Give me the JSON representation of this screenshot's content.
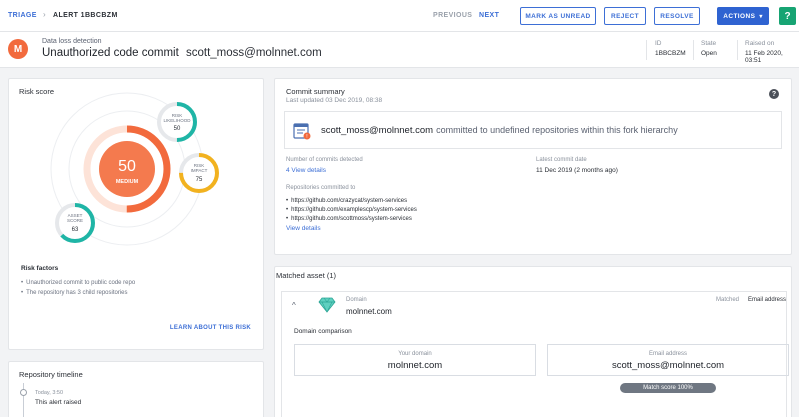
{
  "topbar": {
    "breadcrumb_root": "TRIAGE",
    "breadcrumb_sep": "›",
    "alert_id": "ALERT 1BBCBZM",
    "previous": "PREVIOUS",
    "next": "NEXT",
    "mark_unread": "MARK AS UNREAD",
    "reject": "REJECT",
    "resolve": "RESOLVE",
    "actions": "ACTIONS",
    "actions_caret": "▾",
    "help": "?"
  },
  "header": {
    "avatar_letter": "M",
    "alert_type": "Data loss detection",
    "title": "Unauthorized code commit",
    "email": "scott_moss@molnnet.com",
    "meta": {
      "id_label": "ID",
      "id_value": "1BBCBZM",
      "state_label": "State",
      "state_value": "Open",
      "raised_label": "Raised on",
      "raised_value": "11 Feb 2020, 03:51"
    }
  },
  "risk": {
    "title": "Risk score",
    "score": "50",
    "level": "MEDIUM",
    "likelihood_label_1": "RISK",
    "likelihood_label_2": "LIKELIHOOD",
    "likelihood_value": "50",
    "impact_label_1": "RISK",
    "impact_label_2": "IMPACT",
    "impact_value": "75",
    "asset_label_1": "ASSET",
    "asset_label_2": "SCORE",
    "asset_value": "63",
    "factors_title": "Risk factors",
    "factors": [
      "Unauthorized commit to public code repo",
      "The repository has 3 child repositories"
    ],
    "learn_link": "LEARN ABOUT THIS RISK",
    "colors": {
      "main": "#f26a3d",
      "likelihood": "#1fb5a6",
      "impact": "#f2b21f",
      "asset": "#1fb5a6"
    }
  },
  "timeline": {
    "title": "Repository timeline",
    "time": "Today, 3:50",
    "event": "This alert raised"
  },
  "commit": {
    "title": "Commit summary",
    "updated": "Last updated 03 Dec 2019, 08:38",
    "help": "?",
    "author": "scott_moss@molnnet.com",
    "action": "committed to undefined repositories within this fork hierarchy",
    "num_label": "Number of commits detected",
    "num_link": "4 View details",
    "latest_label": "Latest commit date",
    "latest_value": "11 Dec 2019 (2 months ago)",
    "repos_label": "Repositories committed to",
    "repos": [
      "https://github.com/crazycat/system-services",
      "https://github.com/examplescp/system-services",
      "https://github.com/scottmoss/system-services"
    ],
    "repos_link": "View details"
  },
  "matched": {
    "title": "Matched asset (1)",
    "chevron": "^",
    "asset_kind": "Domain",
    "asset_name": "molnnet.com",
    "matched_label": "Matched",
    "matched_value": "Email address",
    "comparison_title": "Domain comparison",
    "your_domain_label": "Your domain",
    "your_domain_value": "molnnet.com",
    "email_label": "Email address",
    "email_value": "scott_moss@molnnet.com",
    "match_score": "Match score 100%"
  }
}
